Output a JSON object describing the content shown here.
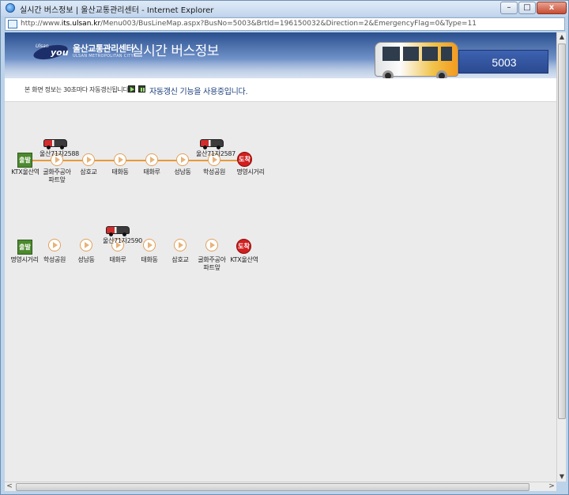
{
  "window": {
    "title": "실시간 버스정보 | 울산교통관리센터 - Internet Explorer",
    "url_prefix": "http://www.",
    "url_domain": "its.ulsan.kr",
    "url_path": "/Menu003/BusLineMap.aspx?BusNo=5003&BrtId=196150032&Direction=2&EmergencyFlag=0&Type=11",
    "minimize": "–",
    "maximize": "□",
    "close": "x"
  },
  "header": {
    "logo_small": "Ulsan",
    "logo_you": "you",
    "center_name": "울산교통관리센터",
    "center_sub": "ULSAN METROPOLITAN CITY",
    "title": "실시간 버스정보",
    "bus_number": "5003"
  },
  "infobar": {
    "refresh_text": "본 화면 정보는 30초마다 자동갱신됩니다.",
    "auto_text": "자동갱신 기능을 사용중입니다."
  },
  "routes": [
    {
      "start_label": "출발",
      "end_label": "도착",
      "stops": [
        "KTX울산역",
        "굴화주공아파트앞",
        "삼호교",
        "태화동",
        "태화루",
        "성남동",
        "학성공원",
        "명영시거리"
      ],
      "buses": [
        {
          "plate": "울산71자2588",
          "after_stop": 1
        },
        {
          "plate": "울산71자2587",
          "after_stop": 6
        }
      ]
    },
    {
      "start_label": "출발",
      "end_label": "도착",
      "stops": [
        "명영시거리",
        "학성공원",
        "성남동",
        "태화루",
        "태화동",
        "삼호교",
        "굴화주공아파트앞",
        "KTX울산역"
      ],
      "buses": [
        {
          "plate": "울산71자2590",
          "after_stop": 3
        }
      ]
    }
  ],
  "route1_labels": {
    "s0": "KTX울산역",
    "s1a": "굴화주공아",
    "s1b": "파트앞",
    "s2": "삼호교",
    "s3": "태화동",
    "s4": "태화루",
    "s5": "성남동",
    "s6": "학성공원",
    "s7": "명영시거리",
    "bus1": "울산71자2588",
    "bus2": "울산71자2587"
  },
  "route2_labels": {
    "s0": "명영시거리",
    "s1": "학성공원",
    "s2": "성남동",
    "s3": "태화루",
    "s4": "태화동",
    "s5": "삼호교",
    "s6a": "굴화주공아",
    "s6b": "파트앞",
    "s7": "KTX울산역",
    "bus1": "울산71자2590"
  },
  "scroll": {
    "up": "▲",
    "down": "▼",
    "left": "<",
    "right": ">"
  },
  "colors": {
    "route_line": "#e79a37",
    "start": "#4c8a2e",
    "end": "#d21f1f",
    "header": "#2a4f8e",
    "bus_number_bg": "#2b4a91"
  }
}
